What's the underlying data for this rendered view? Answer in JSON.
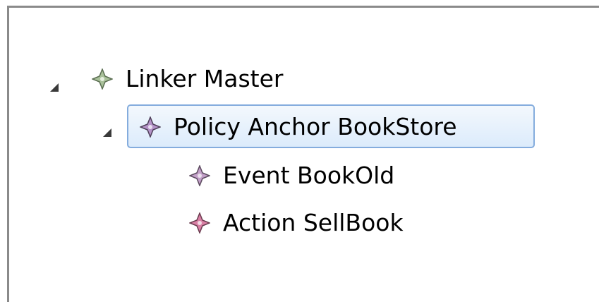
{
  "tree": {
    "nodes": [
      {
        "label": "Linker Master",
        "icon": "linker-diamond-icon",
        "color": "#a9c19a",
        "expanded": true,
        "level": 0
      },
      {
        "label": "Policy Anchor BookStore",
        "icon": "policy-diamond-icon",
        "color": "#b493c8",
        "expanded": true,
        "level": 1,
        "selected": true
      },
      {
        "label": "Event BookOld",
        "icon": "event-diamond-icon",
        "color": "#c3a0c9",
        "level": 2
      },
      {
        "label": "Action SellBook",
        "icon": "action-diamond-icon",
        "color": "#d97fa4",
        "level": 2
      }
    ]
  }
}
